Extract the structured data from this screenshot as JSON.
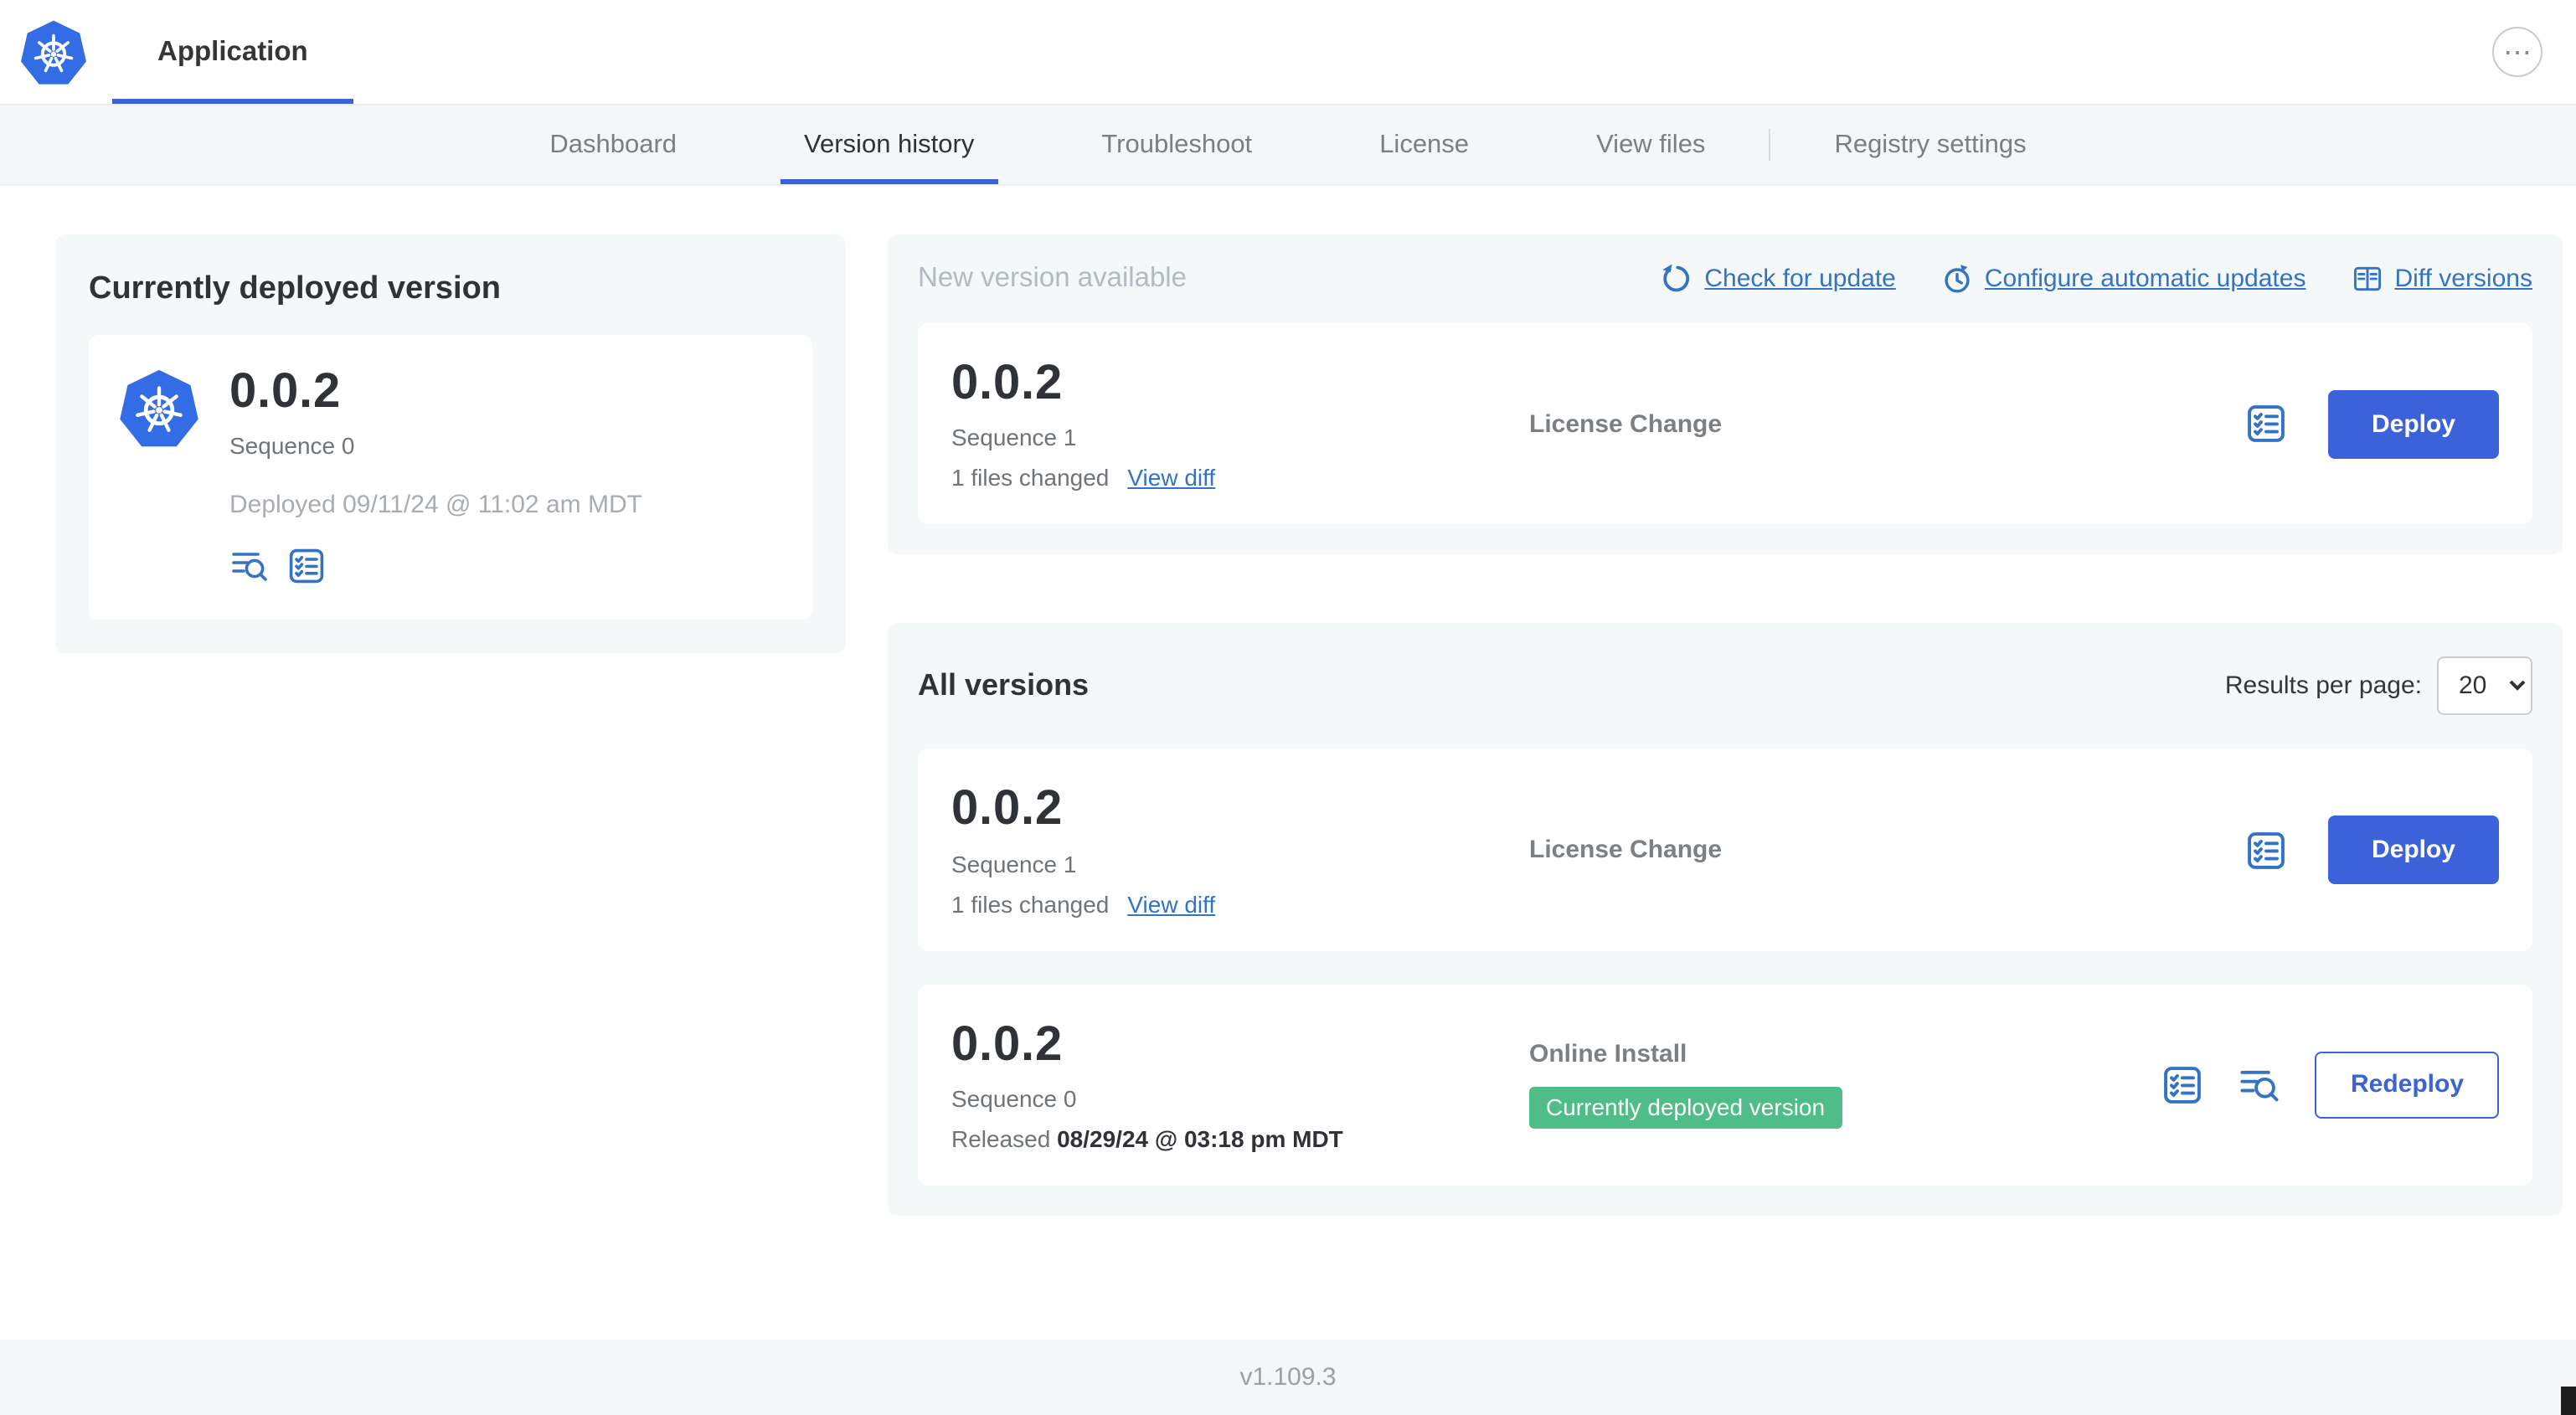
{
  "header": {
    "app_tab": "Application",
    "more_icon": "⋯"
  },
  "nav": {
    "tabs": [
      {
        "label": "Dashboard"
      },
      {
        "label": "Version history"
      },
      {
        "label": "Troubleshoot"
      },
      {
        "label": "License"
      },
      {
        "label": "View files"
      },
      {
        "label": "Registry settings"
      }
    ]
  },
  "current": {
    "title": "Currently deployed version",
    "version": "0.0.2",
    "sequence": "Sequence 0",
    "deployed": "Deployed 09/11/24 @ 11:02 am MDT"
  },
  "new_version": {
    "title": "New version available",
    "check_for_update": "Check for update",
    "configure_updates": "Configure automatic updates",
    "diff_versions": "Diff versions",
    "row": {
      "version": "0.0.2",
      "sequence": "Sequence 1",
      "files_changed": "1 files changed",
      "view_diff": "View diff",
      "change_type": "License Change",
      "action": "Deploy"
    }
  },
  "all_versions": {
    "title": "All versions",
    "results_label": "Results per page:",
    "results_value": "20",
    "rows": [
      {
        "version": "0.0.2",
        "sequence": "Sequence 1",
        "files_changed": "1 files changed",
        "view_diff": "View diff",
        "change_type": "License Change",
        "action": "Deploy"
      },
      {
        "version": "0.0.2",
        "sequence": "Sequence 0",
        "released_prefix": "Released",
        "released_date": "08/29/24 @ 03:18 pm MDT",
        "change_type": "Online Install",
        "badge": "Currently deployed version",
        "action": "Redeploy"
      }
    ]
  },
  "footer": {
    "version": "v1.109.3"
  },
  "colors": {
    "brand": "#326de6",
    "accent": "#3b62d9",
    "link": "#3273c5",
    "green": "#4fbd87",
    "card-bg": "#f5f8f9",
    "bar-bg": "#f4f6f8"
  }
}
